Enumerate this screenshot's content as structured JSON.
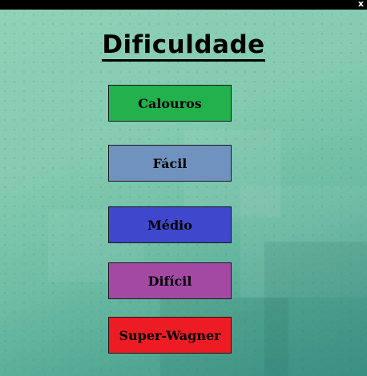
{
  "window": {
    "close_label": "x"
  },
  "title": "Dificuldade",
  "buttons": [
    {
      "label": "Calouros",
      "color": "#22b14c"
    },
    {
      "label": "Fácil",
      "color": "#7092be"
    },
    {
      "label": "Médio",
      "color": "#3f48cc"
    },
    {
      "label": "Difícil",
      "color": "#a349a4"
    },
    {
      "label": "Super-Wagner",
      "color": "#ed1c24"
    }
  ]
}
